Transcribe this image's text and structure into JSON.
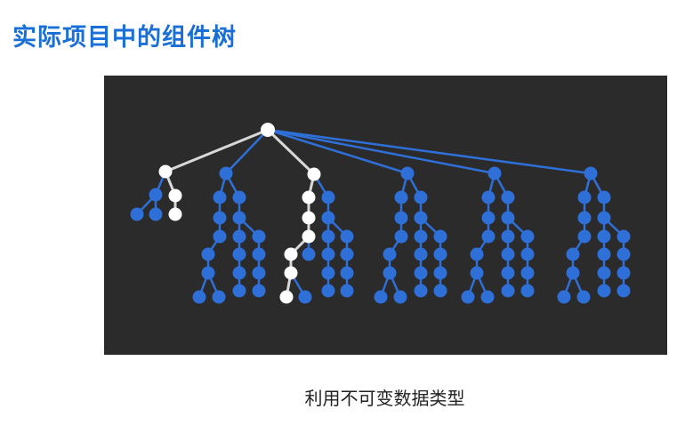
{
  "page": {
    "title": "实际项目中的组件树",
    "caption": "利用不可变数据类型"
  },
  "colors": {
    "title": "#1a6fd6",
    "panel_background": "#2b2b2b",
    "node_default": "#2f6fd8",
    "edge_default": "#2f6fd8",
    "node_highlight": "#ffffff",
    "edge_highlight": "#d8d8d8"
  },
  "diagram": {
    "type": "tree",
    "node_count": 108,
    "highlighted_path_from_root": 2
  }
}
